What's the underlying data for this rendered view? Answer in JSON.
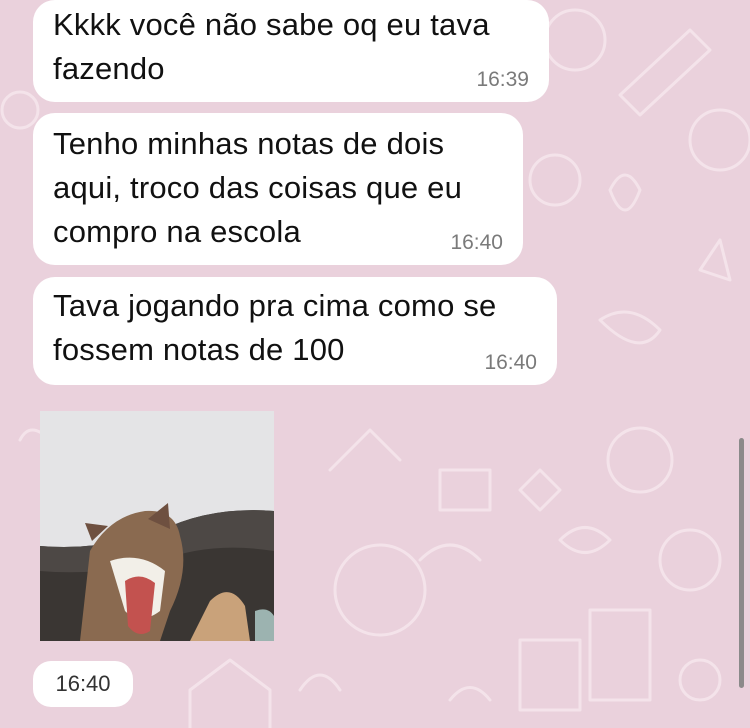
{
  "messages": [
    {
      "text": "Kkkk você não sabe oq eu tava\nfazendo",
      "time": "16:39"
    },
    {
      "text": "Tenho minhas notas de dois\naqui, troco das coisas que eu\ncompro na escola",
      "time": "16:40"
    },
    {
      "text": "Tava jogando pra cima como se\nfossem notas de 100",
      "time": "16:40"
    }
  ],
  "media_message": {
    "time": "16:40",
    "icon": "dog-video-thumbnail"
  },
  "colors": {
    "wallpaper": "#ead1dc",
    "bubble": "#ffffff",
    "timestamp": "#7a7a7a"
  }
}
